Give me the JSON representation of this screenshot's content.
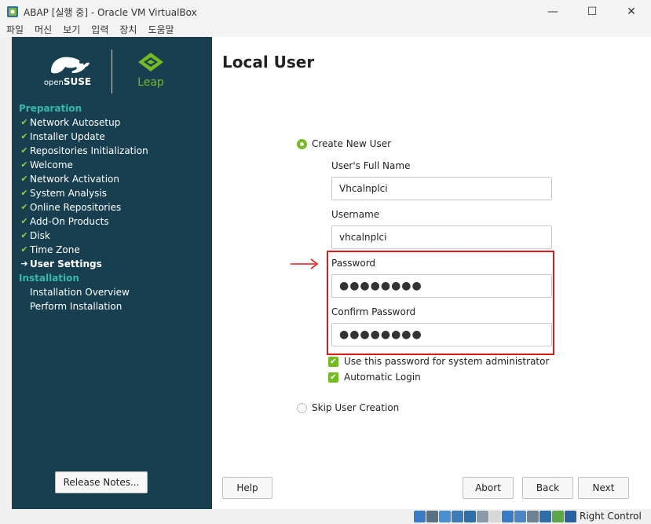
{
  "window": {
    "title": "ABAP [실행 중] - Oracle VM VirtualBox",
    "minimize": "—",
    "maximize": "☐",
    "close": "✕"
  },
  "menu": [
    "파일",
    "머신",
    "보기",
    "입력",
    "장치",
    "도움말"
  ],
  "branding": {
    "opensuse_prefix": "open",
    "opensuse_suffix": "SUSE",
    "leap": "Leap"
  },
  "sidebar": {
    "sections": [
      {
        "heading": "Preparation",
        "steps": [
          {
            "label": "Network Autosetup",
            "state": "done"
          },
          {
            "label": "Installer Update",
            "state": "done"
          },
          {
            "label": "Repositories Initialization",
            "state": "done"
          },
          {
            "label": "Welcome",
            "state": "done"
          },
          {
            "label": "Network Activation",
            "state": "done"
          },
          {
            "label": "System Analysis",
            "state": "done"
          },
          {
            "label": "Online Repositories",
            "state": "done"
          },
          {
            "label": "Add-On Products",
            "state": "done"
          },
          {
            "label": "Disk",
            "state": "done"
          },
          {
            "label": "Time Zone",
            "state": "done"
          },
          {
            "label": "User Settings",
            "state": "current"
          }
        ]
      },
      {
        "heading": "Installation",
        "steps": [
          {
            "label": "Installation Overview",
            "state": "pending"
          },
          {
            "label": "Perform Installation",
            "state": "pending"
          }
        ]
      }
    ],
    "release_notes": "Release Notes..."
  },
  "main": {
    "title": "Local User",
    "create_new_user": "Create New User",
    "full_name_label": "User's Full Name",
    "full_name_value": "Vhcalnplci",
    "username_label": "Username",
    "username_value": "vhcalnplci",
    "password_label": "Password",
    "password_value": "●●●●●●●●",
    "confirm_label": "Confirm Password",
    "confirm_value": "●●●●●●●●",
    "use_for_admin": "Use this password for system administrator",
    "automatic_login": "Automatic Login",
    "skip_user_creation": "Skip User Creation"
  },
  "buttons": {
    "help": "Help",
    "abort": "Abort",
    "back": "Back",
    "next": "Next"
  },
  "status": {
    "host_key": "Right Control"
  },
  "colors": {
    "sidebar_bg": "#173f4f",
    "accent_green": "#73ba25",
    "section_teal": "#35b9ab",
    "highlight_red": "#e01818"
  }
}
